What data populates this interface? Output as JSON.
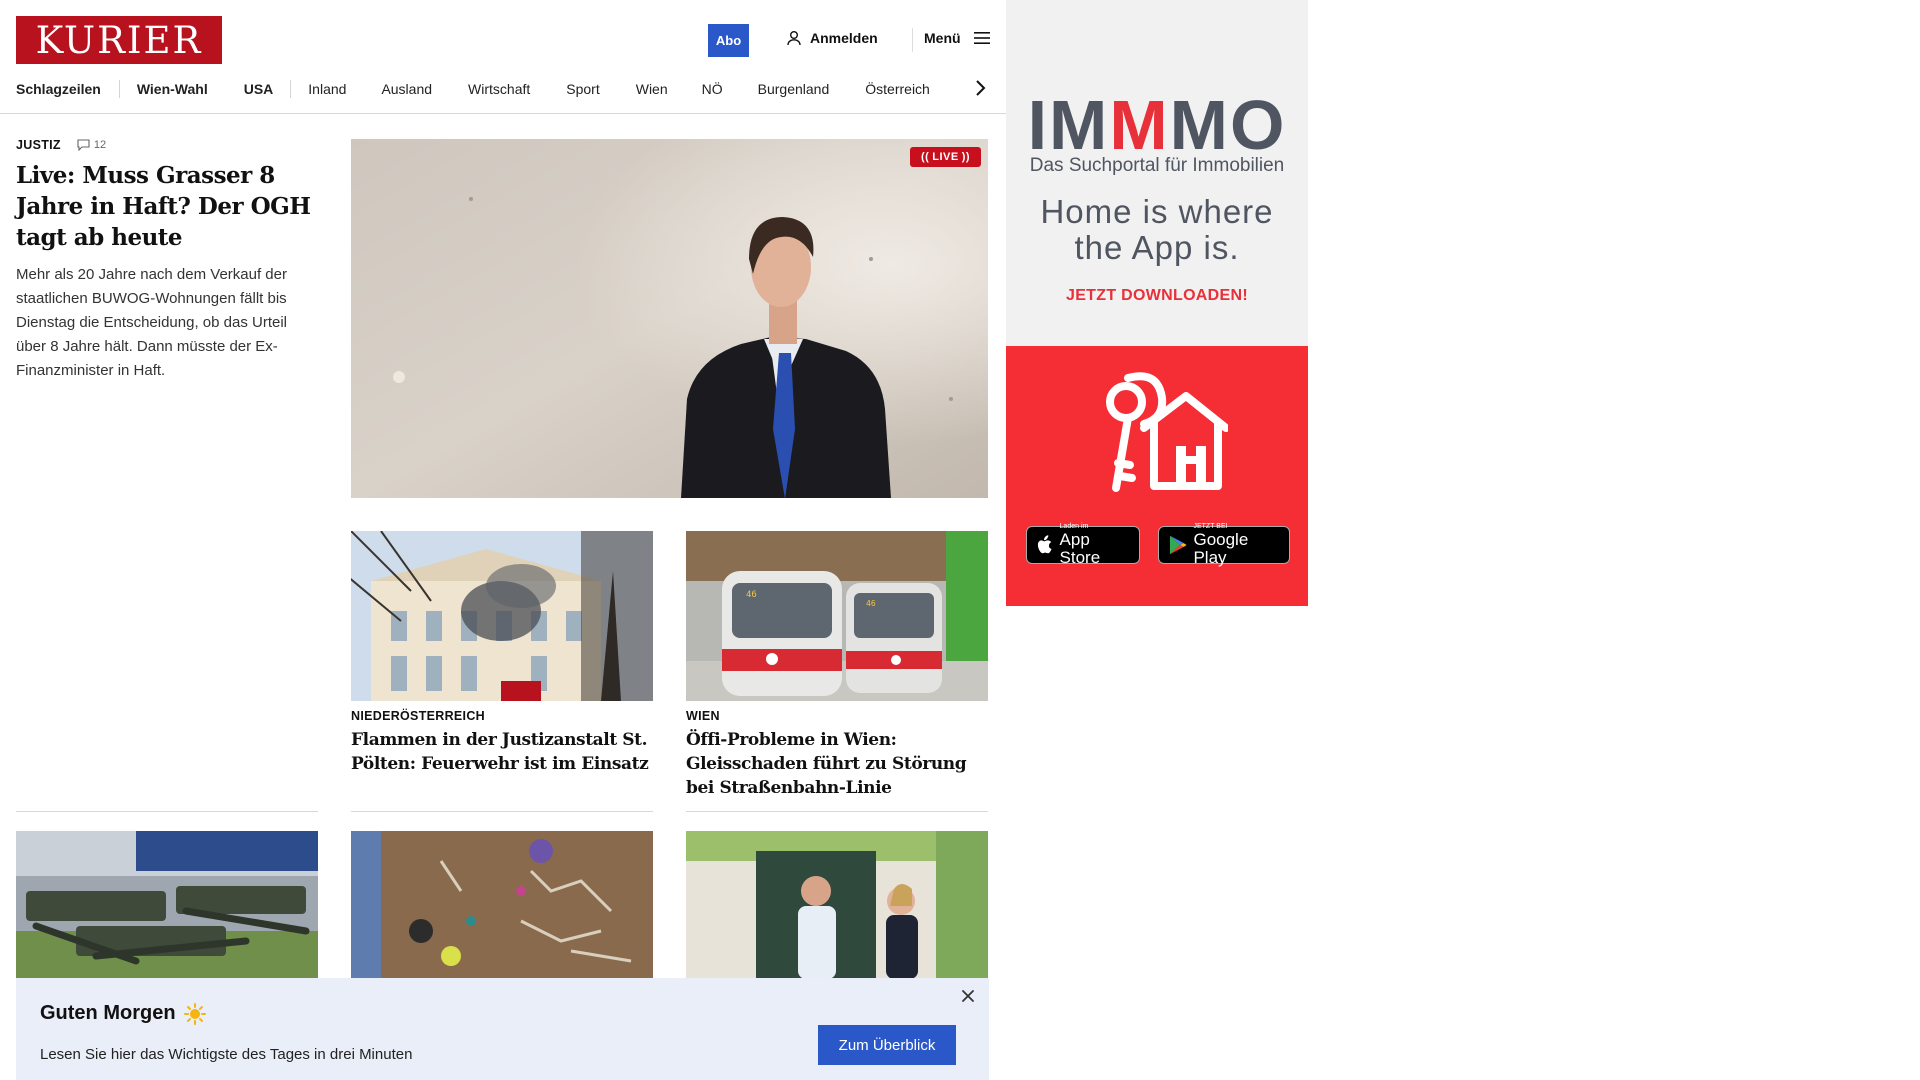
{
  "header": {
    "logo": "KURIER",
    "abo_label": "Abo",
    "login_label": "Anmelden",
    "menu_label": "Menü"
  },
  "nav": {
    "items": [
      "Schlagzeilen",
      "Wien-Wahl",
      "USA",
      "Inland",
      "Ausland",
      "Wirtschaft",
      "Sport",
      "Wien",
      "NÖ",
      "Burgenland",
      "Österreich"
    ]
  },
  "lead": {
    "kicker": "JUSTIZ",
    "comments": "12",
    "title": "Live: Muss Grasser 8 Jahre in Haft? Der OGH tagt ab heute",
    "teaser": "Mehr als 20 Jahre nach dem Verkauf der staatlichen BUWOG-Wohnungen fällt bis Dienstag die Entscheidung, ob das Urteil über 8 Jahre hält. Dann müsste der Ex-Finanzminister in Haft.",
    "live_badge": "LIVE"
  },
  "cards": [
    {
      "kicker": "NIEDERÖSTERREICH",
      "title": "Flammen in der Justizanstalt St. Pölten: Feuerwehr ist im Einsatz"
    },
    {
      "kicker": "WIEN",
      "title": "Öffi-Probleme in Wien: Gleisschaden führt zu Störung bei Straßenbahn-Linie"
    }
  ],
  "banner": {
    "title": "Guten Morgen",
    "subtitle": "Lesen Sie hier das Wichtigste des Tages in drei Minuten",
    "cta": "Zum Überblick"
  },
  "ad": {
    "brand_pre": "IM",
    "brand_m": "M",
    "brand_post": "MO",
    "tagline": "Das Suchportal für Immobilien",
    "headline_1": "Home is where",
    "headline_2": "the App is.",
    "cta": "JETZT DOWNLOADEN!",
    "appstore_small": "Laden im",
    "appstore_big": "App Store",
    "googleplay_small": "JETZT BEI",
    "googleplay_big": "Google Play"
  },
  "colors": {
    "brand_red": "#b8121e",
    "accent_blue": "#2a58c9",
    "live_red": "#c80f1e",
    "ad_red": "#f52d35",
    "banner_bg": "#e9eef8"
  }
}
